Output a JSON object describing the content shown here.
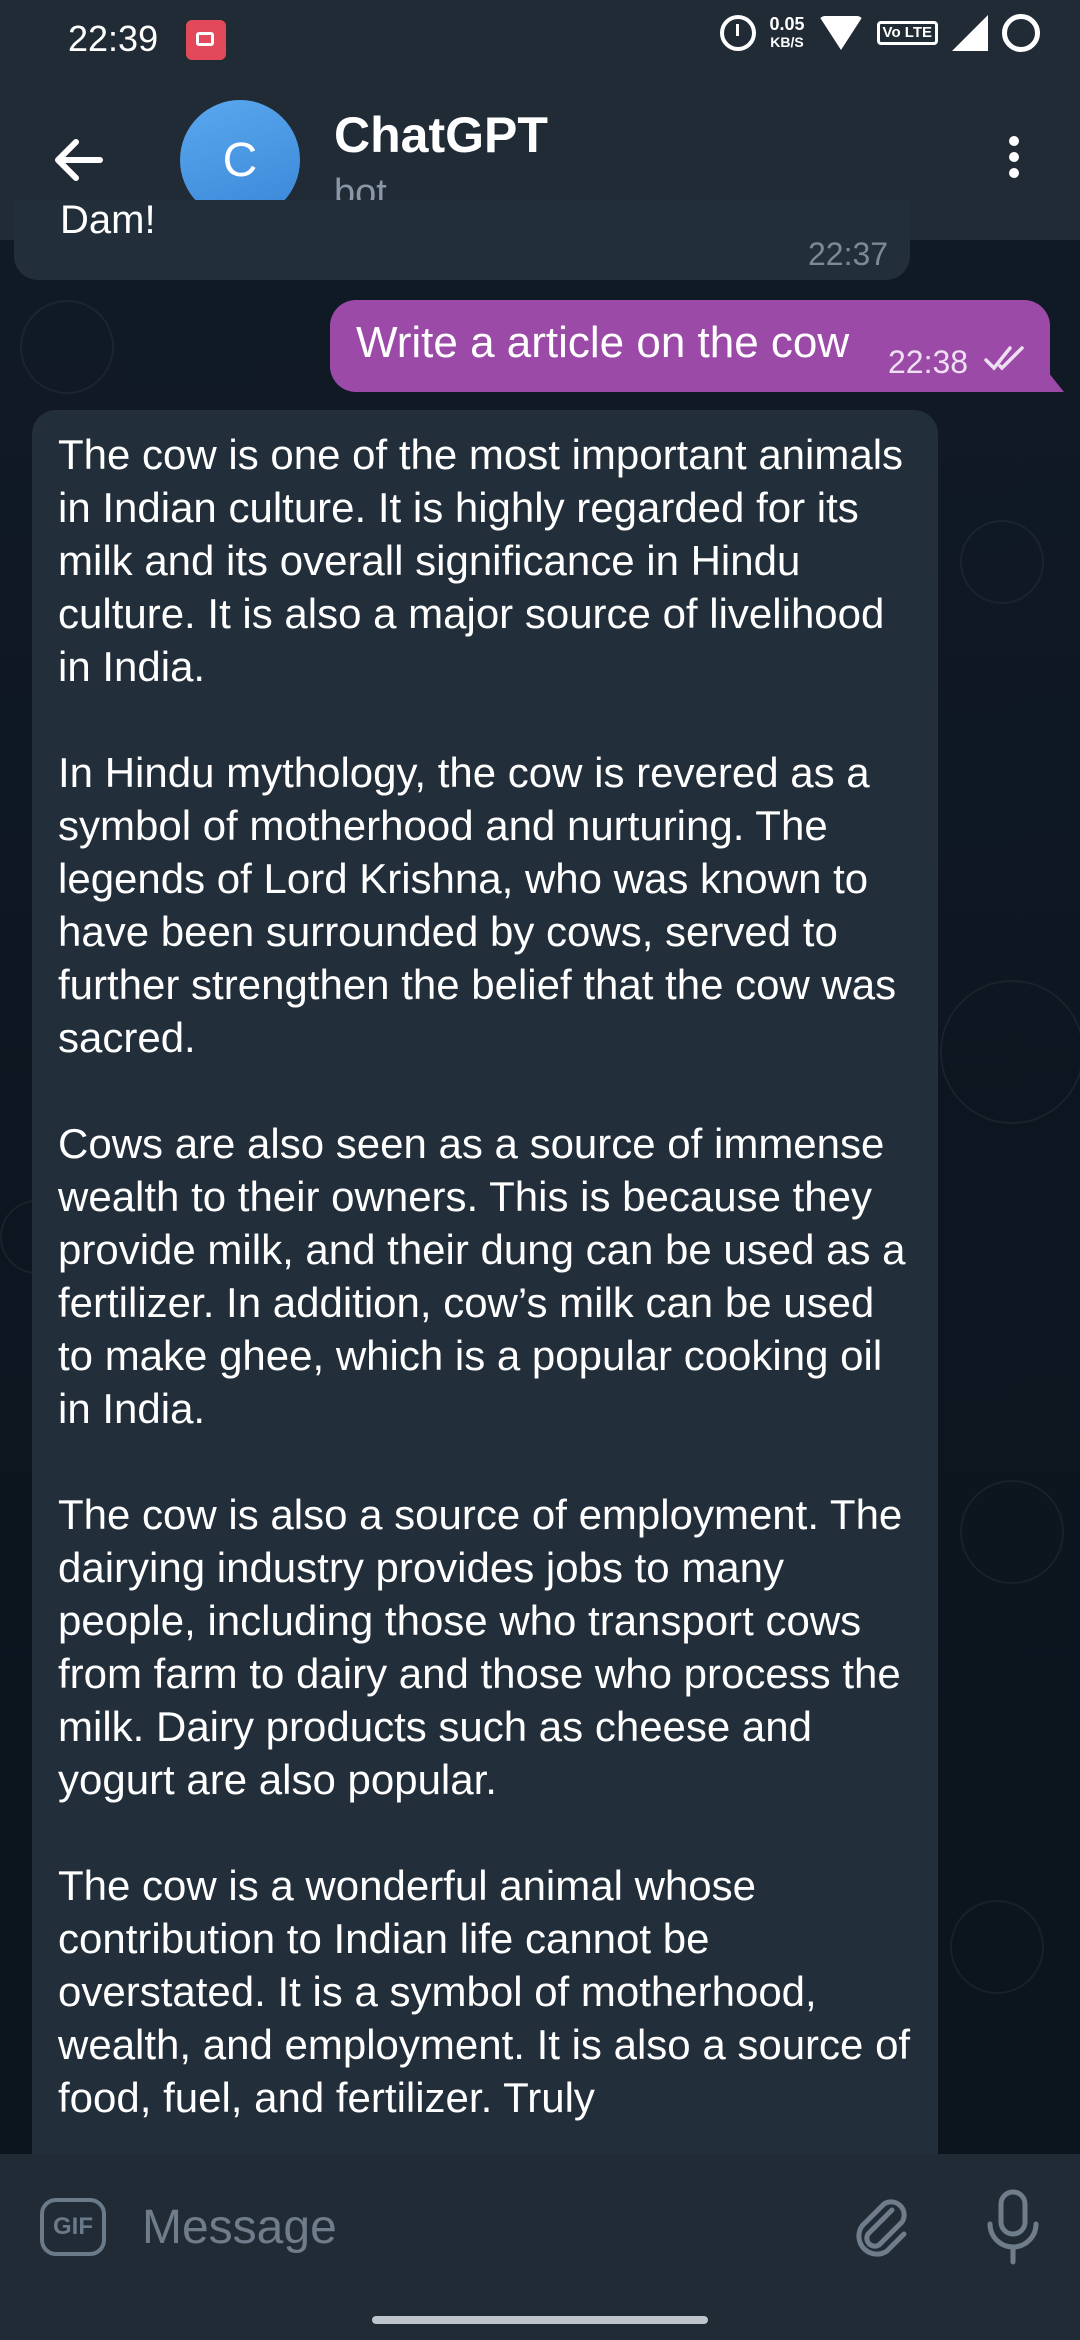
{
  "status_bar": {
    "time": "22:39",
    "net_speed_value": "0.05",
    "net_speed_unit": "KB/S",
    "volte_label": "Vo LTE",
    "icons": [
      "screen-record-icon",
      "alarm-icon",
      "wifi-icon",
      "volte-icon",
      "signal-icon",
      "ring-icon"
    ]
  },
  "header": {
    "avatar_letter": "C",
    "title": "ChatGPT",
    "subtitle": "bot",
    "icons": [
      "back-arrow-icon",
      "more-vertical-icon"
    ]
  },
  "messages": {
    "previous": {
      "text": "Dam!",
      "time": "22:37"
    },
    "outgoing": {
      "text": "Write a article on the cow",
      "time": "22:38",
      "status": "read"
    },
    "incoming": {
      "paragraphs": [
        "The cow is one of the most important animals in Indian culture. It is highly regarded for its milk and its overall significance in Hindu culture. It is also a major source of livelihood in India.",
        "In Hindu mythology, the cow is revered as a symbol of motherhood and nurturing. The legends of Lord Krishna, who was known to have been surrounded by cows, served to further strengthen the belief that the cow was sacred.",
        "Cows are also seen as a source of immense wealth to their owners. This is because they provide milk, and their dung can be used as a fertilizer. In addition, cow’s milk can be used to make ghee, which is a popular cooking oil in India.",
        "The cow is also a source of employment. The dairying industry provides jobs to many people, including those who transport cows from farm to dairy and those who process the milk. Dairy products such as cheese and yogurt are also popular.",
        "The cow is a wonderful animal whose contribution to Indian life cannot be overstated. It is a symbol of motherhood, wealth, and employment. It is also a source of food, fuel, and fertilizer. Truly"
      ]
    }
  },
  "input_bar": {
    "gif_label": "GIF",
    "placeholder": "Message",
    "icons": [
      "gif-icon",
      "attach-icon",
      "mic-icon"
    ]
  },
  "colors": {
    "bar": "#202b36",
    "background": "#0f1823",
    "incoming_bubble": "#222e3a",
    "outgoing_bubble": "#9c4aa8",
    "avatar": "#4a97e4",
    "record_icon": "#e24a5a"
  }
}
